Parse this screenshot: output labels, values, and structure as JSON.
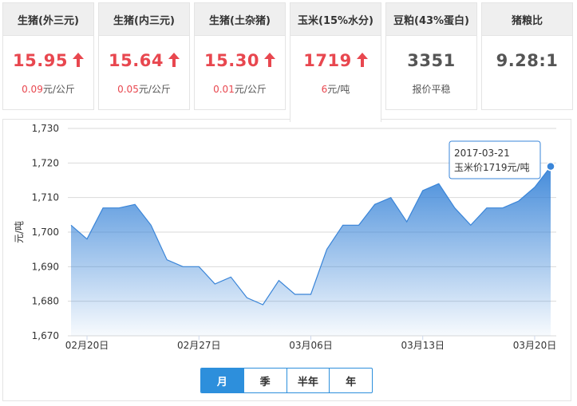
{
  "cards": [
    {
      "title": "生猪(外三元)",
      "price": "15.95",
      "change": "0.09",
      "unit": "元/公斤",
      "trend": "up"
    },
    {
      "title": "生猪(内三元)",
      "price": "15.64",
      "change": "0.05",
      "unit": "元/公斤",
      "trend": "up"
    },
    {
      "title": "生猪(土杂猪)",
      "price": "15.30",
      "change": "0.01",
      "unit": "元/公斤",
      "trend": "up"
    },
    {
      "title": "玉米(15%水分)",
      "price": "1719",
      "change": "6",
      "unit": "元/吨",
      "trend": "up"
    },
    {
      "title": "豆粕(43%蛋白)",
      "price": "3351",
      "note": "报价平稳",
      "trend": "flat"
    },
    {
      "title": "猪粮比",
      "price": "9.28:1",
      "trend": "none"
    }
  ],
  "colors": {
    "up": "#e8474f",
    "series": "#3a85d8",
    "accent": "#2d8fdc"
  },
  "chart_data": {
    "type": "area",
    "ylabel": "元/吨",
    "ylim": [
      1670,
      1730
    ],
    "yticks": [
      "1,670",
      "1,680",
      "1,690",
      "1,700",
      "1,710",
      "1,720",
      "1,730"
    ],
    "ytick_values": [
      1670,
      1680,
      1690,
      1700,
      1710,
      1720,
      1730
    ],
    "xtick_labels": [
      "02月20日",
      "02月27日",
      "03月06日",
      "03月13日",
      "03月20日"
    ],
    "xtick_index": [
      1,
      8,
      15,
      22,
      29
    ],
    "grid": true,
    "series": [
      {
        "values": [
          1702,
          1698,
          1707,
          1707,
          1708,
          1702,
          1692,
          1690,
          1690,
          1685,
          1687,
          1681,
          1679,
          1686,
          1682,
          1682,
          1695,
          1702,
          1702,
          1708,
          1710,
          1703,
          1712,
          1714,
          1707,
          1702,
          1707,
          1707,
          1709,
          1713,
          1719
        ]
      }
    ],
    "tooltip": {
      "date": "2017-03-21",
      "text": "玉米价1719元/吨"
    }
  },
  "range_buttons": [
    {
      "label": "月",
      "active": true
    },
    {
      "label": "季"
    },
    {
      "label": "半年"
    },
    {
      "label": "年"
    }
  ]
}
